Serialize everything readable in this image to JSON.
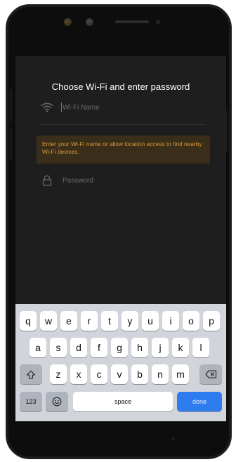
{
  "screen": {
    "title": "Choose Wi-Fi and enter password",
    "wifi_placeholder": "Wi-Fi Name",
    "notice": "Enter your Wi-Fi name or allow location access to find nearby Wi-Fi devices.",
    "password_placeholder": "Password"
  },
  "keyboard": {
    "row1": [
      "q",
      "w",
      "e",
      "r",
      "t",
      "y",
      "u",
      "i",
      "o",
      "p"
    ],
    "row2": [
      "a",
      "s",
      "d",
      "f",
      "g",
      "h",
      "j",
      "k",
      "l"
    ],
    "row3": [
      "z",
      "x",
      "c",
      "v",
      "b",
      "n",
      "m"
    ],
    "numbers_label": "123",
    "space_label": "space",
    "done_label": "done",
    "shift_icon": "shift-icon",
    "delete_icon": "delete-icon",
    "emoji_icon": "emoji-icon"
  },
  "colors": {
    "screen_bg": "#1e1e1e",
    "notice_text": "#d99a3c",
    "notice_bg": "#3a2d19",
    "done_key": "#2f7cf0",
    "keyboard_bg": "#d1d4da"
  }
}
